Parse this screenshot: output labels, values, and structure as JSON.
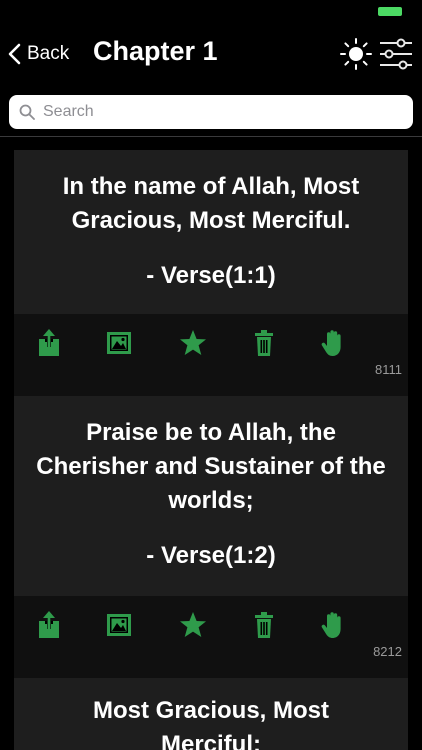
{
  "nav": {
    "back_label": "Back",
    "title": "Chapter 1"
  },
  "search": {
    "placeholder": "Search",
    "value": ""
  },
  "colors": {
    "accent_green": "#2f9b4b",
    "card_background": "#1e1e1e",
    "battery": "#4cd964"
  },
  "icons": [
    "sun-icon",
    "sliders-icon",
    "search-icon",
    "share-icon",
    "image-icon",
    "star-icon",
    "trash-icon",
    "hand-icon"
  ],
  "verses": [
    {
      "text": "In the name of Allah, Most Gracious, Most Merciful.",
      "reference": "- Verse(1:1)",
      "count": "8111"
    },
    {
      "text": "Praise be to Allah, the Cherisher and Sustainer of the worlds;",
      "reference": "- Verse(1:2)",
      "count": "8212"
    },
    {
      "text": "Most Gracious, Most Merciful;",
      "reference": ""
    }
  ]
}
